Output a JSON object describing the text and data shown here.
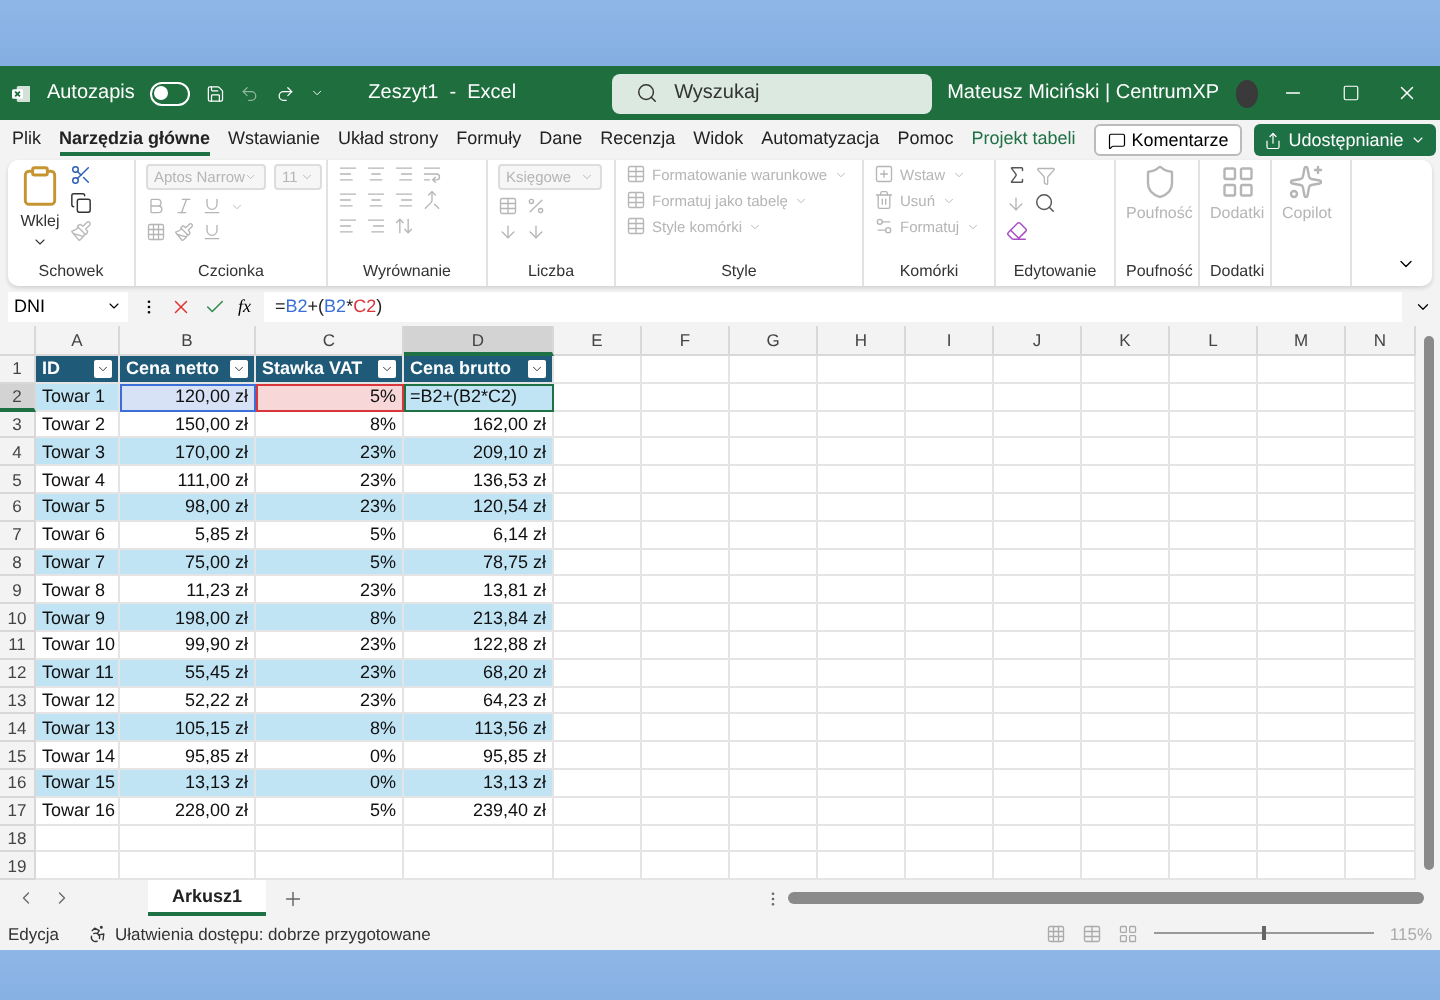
{
  "title_bar": {
    "app_label": "Autozapis",
    "autosave_on": false,
    "document": "Zeszyt1  -  Excel",
    "search_placeholder": "Wyszukaj",
    "user": "Mateusz Miciński | CentrumXP"
  },
  "menu": {
    "tabs": [
      {
        "label": "Plik",
        "selected": false,
        "kind": "normal"
      },
      {
        "label": "Narzędzia główne",
        "selected": true,
        "kind": "normal"
      },
      {
        "label": "Wstawianie",
        "selected": false,
        "kind": "normal"
      },
      {
        "label": "Układ strony",
        "selected": false,
        "kind": "normal"
      },
      {
        "label": "Formuły",
        "selected": false,
        "kind": "normal"
      },
      {
        "label": "Dane",
        "selected": false,
        "kind": "normal"
      },
      {
        "label": "Recenzja",
        "selected": false,
        "kind": "normal"
      },
      {
        "label": "Widok",
        "selected": false,
        "kind": "normal"
      },
      {
        "label": "Automatyzacja",
        "selected": false,
        "kind": "normal"
      },
      {
        "label": "Pomoc",
        "selected": false,
        "kind": "normal"
      },
      {
        "label": "Projekt tabeli",
        "selected": false,
        "kind": "contextual"
      }
    ],
    "comments_button": "Komentarze",
    "share_button": "Udostępnianie"
  },
  "ribbon": {
    "disabled": true,
    "groups": [
      {
        "kind": "clipboard",
        "label": "Schowek",
        "paste": "Wklej"
      },
      {
        "kind": "font",
        "label": "Czcionka",
        "font": "Aptos Narrow",
        "size": "11"
      },
      {
        "kind": "alignment",
        "label": "Wyrównanie"
      },
      {
        "kind": "number",
        "label": "Liczba",
        "format": "Księgowe"
      },
      {
        "kind": "styles",
        "label": "Style",
        "items": [
          "Formatowanie warunkowe",
          "Formatuj jako tabelę",
          "Style komórki"
        ]
      },
      {
        "kind": "cells",
        "label": "Komórki",
        "items": [
          "Wstaw",
          "Usuń",
          "Formatuj"
        ]
      },
      {
        "kind": "editing",
        "label": "Edytowanie"
      },
      {
        "kind": "sensitivity",
        "label": "Poufność",
        "button": "Poufność"
      },
      {
        "kind": "addins",
        "label": "Dodatki",
        "button": "Dodatki"
      },
      {
        "kind": "copilot",
        "button": "Copilot"
      }
    ]
  },
  "formula_bar": {
    "name_box": "DNI",
    "function_label": "fx",
    "formula": [
      {
        "text": "=",
        "kind": "plain"
      },
      {
        "text": "B2",
        "kind": "ref",
        "color": "#3a6fd8"
      },
      {
        "text": "+(",
        "kind": "plain"
      },
      {
        "text": "B2",
        "kind": "ref",
        "color": "#3a6fd8"
      },
      {
        "text": "*",
        "kind": "plain"
      },
      {
        "text": "C2",
        "kind": "ref",
        "color": "#d8363a"
      },
      {
        "text": ")",
        "kind": "plain"
      }
    ]
  },
  "sheet": {
    "column_headers": [
      "A",
      "B",
      "C",
      "D",
      "E",
      "F",
      "G",
      "H",
      "I",
      "J",
      "K",
      "L",
      "M",
      "N"
    ],
    "row_numbers": [
      "1",
      "2",
      "3",
      "4",
      "5",
      "6",
      "7",
      "8",
      "9",
      "10",
      "11",
      "12",
      "13",
      "14",
      "15",
      "16",
      "17",
      "18",
      "19"
    ],
    "table": {
      "columns": [
        "ID",
        "Cena netto",
        "Stawka VAT",
        "Cena brutto"
      ],
      "rows": [
        {
          "cells": [
            "Towar 1",
            {
              "text": "120,00 zł",
              "color": "#3a6fd8"
            },
            {
              "text": "5%",
              "color": "#d8363a"
            },
            {
              "text": "=B2+(B2*C2)",
              "editing": true
            }
          ]
        },
        {
          "cells": [
            "Towar 2",
            "150,00 zł",
            "8%",
            "162,00 zł"
          ]
        },
        {
          "cells": [
            "Towar 3",
            "170,00 zł",
            "23%",
            "209,10 zł"
          ]
        },
        {
          "cells": [
            "Towar 4",
            "111,00 zł",
            "23%",
            "136,53 zł"
          ]
        },
        {
          "cells": [
            "Towar 5",
            "98,00 zł",
            "23%",
            "120,54 zł"
          ]
        },
        {
          "cells": [
            "Towar 6",
            "5,85 zł",
            "5%",
            "6,14 zł"
          ]
        },
        {
          "cells": [
            "Towar 7",
            "75,00 zł",
            "5%",
            "78,75 zł"
          ]
        },
        {
          "cells": [
            "Towar 8",
            "11,23 zł",
            "23%",
            "13,81 zł"
          ]
        },
        {
          "cells": [
            "Towar 9",
            "198,00 zł",
            "8%",
            "213,84 zł"
          ]
        },
        {
          "cells": [
            "Towar 10",
            "99,90 zł",
            "23%",
            "122,88 zł"
          ]
        },
        {
          "cells": [
            "Towar 11",
            "55,45 zł",
            "23%",
            "68,20 zł"
          ]
        },
        {
          "cells": [
            "Towar 12",
            "52,22 zł",
            "23%",
            "64,23 zł"
          ]
        },
        {
          "cells": [
            "Towar 13",
            "105,15 zł",
            "8%",
            "113,56 zł"
          ]
        },
        {
          "cells": [
            "Towar 14",
            "95,85 zł",
            "0%",
            "95,85 zł"
          ]
        },
        {
          "cells": [
            "Towar 15",
            "13,13 zł",
            "0%",
            "13,13 zł"
          ]
        },
        {
          "cells": [
            "Towar 16",
            "228,00 zł",
            "5%",
            "239,40 zł"
          ]
        }
      ]
    }
  },
  "sheet_tabs": [
    {
      "label": "Arkusz1",
      "selected": true
    }
  ],
  "status_bar": {
    "mode": "Edycja",
    "accessibility": "Ułatwienia dostępu: dobrze przygotowane",
    "zoom": "115%",
    "zoom_slider": {
      "level": 0.5
    }
  }
}
